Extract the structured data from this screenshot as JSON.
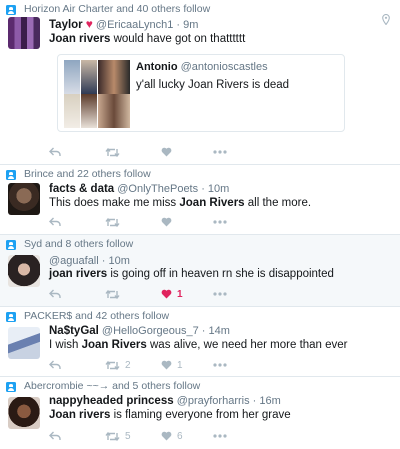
{
  "tweets": [
    {
      "context": "Horizon Air Charter and 40 others follow",
      "name": "Taylor",
      "handle": "@EricaaLynch1",
      "time": "· 9m",
      "text_bold": "Joan rivers",
      "text_rest": " would have got on thatttttt",
      "quote": {
        "name": "Antonio",
        "handle": "@antonioscastles",
        "text": "y'all lucky Joan Rivers is dead"
      },
      "retweets": "",
      "likes": ""
    },
    {
      "context": "Brince and 22 others follow",
      "name": "facts & data",
      "handle": "@OnlyThePoets",
      "time": "· 10m",
      "text_pre": "This does make me miss ",
      "text_bold": "Joan Rivers",
      "text_rest": " all the more.",
      "retweets": "",
      "likes": ""
    },
    {
      "context": "Syd and 8 others follow",
      "name": "",
      "handle": "@aguafall",
      "time": "· 10m",
      "text_bold": "joan rivers",
      "text_rest": " is going off in heaven rn she is disappointed",
      "retweets": "",
      "likes": "1"
    },
    {
      "context": "PACKER$ and 42 others follow",
      "name": "Na$tyGal",
      "handle": "@HelloGorgeous_7",
      "time": "· 14m",
      "text_pre": "I wish ",
      "text_bold": "Joan Rivers",
      "text_rest": " was alive, we need her more than ever",
      "retweets": "2",
      "likes": "1"
    },
    {
      "context": "Abercrombie ~~→ and 5 others follow",
      "name": "nappyheaded princess",
      "handle": "@prayforharris",
      "time": "· 16m",
      "text_bold": "Joan rivers",
      "text_rest": " is flaming everyone from her grave",
      "retweets": "5",
      "likes": "6"
    }
  ],
  "colors": {
    "accent": "#1da1f2",
    "like": "#e0245e",
    "icon": "#aab8c2",
    "muted": "#657786"
  }
}
